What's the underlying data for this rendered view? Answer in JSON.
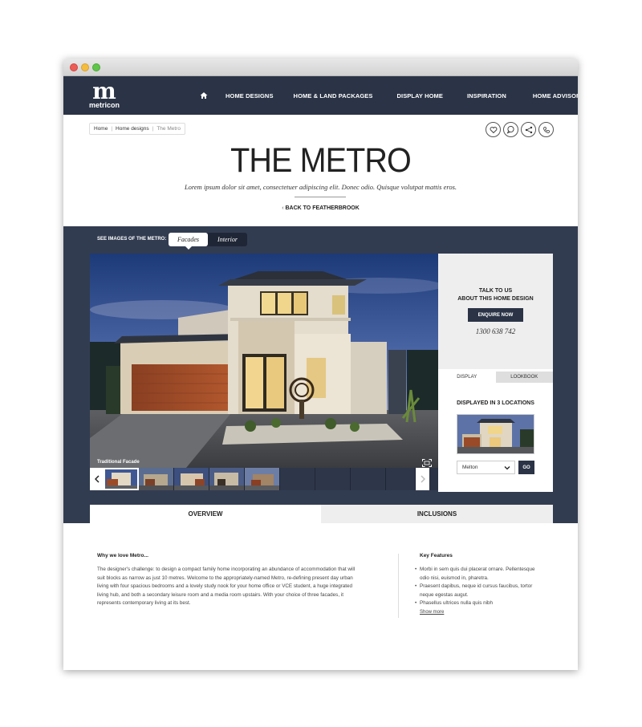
{
  "nav": {
    "logo_mark": "m",
    "logo_word": "metricon",
    "links": [
      "HOME DESIGNS",
      "HOME & LAND PACKAGES",
      "DISPLAY HOME",
      "INSPIRATION",
      "HOME ADVISOR"
    ]
  },
  "breadcrumb": [
    "Home",
    "Home designs",
    "The Metro"
  ],
  "page": {
    "title": "THE METRO",
    "subtitle": "Lorem ipsum dolor sit amet, consectetuer adipiscing elit. Donec odio. Quisque volutpat mattis eros.",
    "back_link": "BACK TO FEATHERBROOK"
  },
  "gallery": {
    "see_label": "SEE IMAGES OF THE METRO:",
    "toggle": [
      "Facades",
      "Interior"
    ],
    "caption": "Traditional Facade"
  },
  "sidepanel": {
    "talk_line1": "TALK TO US",
    "talk_line2": "ABOUT THIS HOME DESIGN",
    "enquire": "ENQUIRE NOW",
    "phone": "1300 638 742",
    "tabs": [
      "DISPLAY",
      "LOOKBOOK"
    ],
    "displayed_in": "DISPLAYED IN 3 LOCATIONS",
    "location": "Melton",
    "go": "GO"
  },
  "content_tabs": [
    "OVERVIEW",
    "INCLUSIONS"
  ],
  "overview": {
    "why_title": "Why we love Metro...",
    "why_body": "The designer's challenge: to design a compact family home incorporating an abundance of accommodation that will suit blocks as narrow as just 10 metres. Welcome to the appropriately-named Metro, re-defining present day urban living with four spacious bedrooms and a lovely study nook for your home office or VCE student, a huge integrated living hub, and both a secondary leisure room and a media room upstairs. With your choice of three facades, it represents contemporary living at its best.",
    "features_title": "Key Features",
    "features": [
      "Morbi in sem quis dui placerat ornare. Pellentesque odio nisi, euismod in, pharetra.",
      "Praesent dapibus, neque id cursus faucibus, tortor neque egestas augut.",
      "Phasellus ultrices nulla quis nibh"
    ],
    "show_more": "Show more"
  },
  "colors": {
    "nav_bg": "#2b3446",
    "gallery_bg": "#323c51",
    "panel_grey": "#eeeeee"
  }
}
